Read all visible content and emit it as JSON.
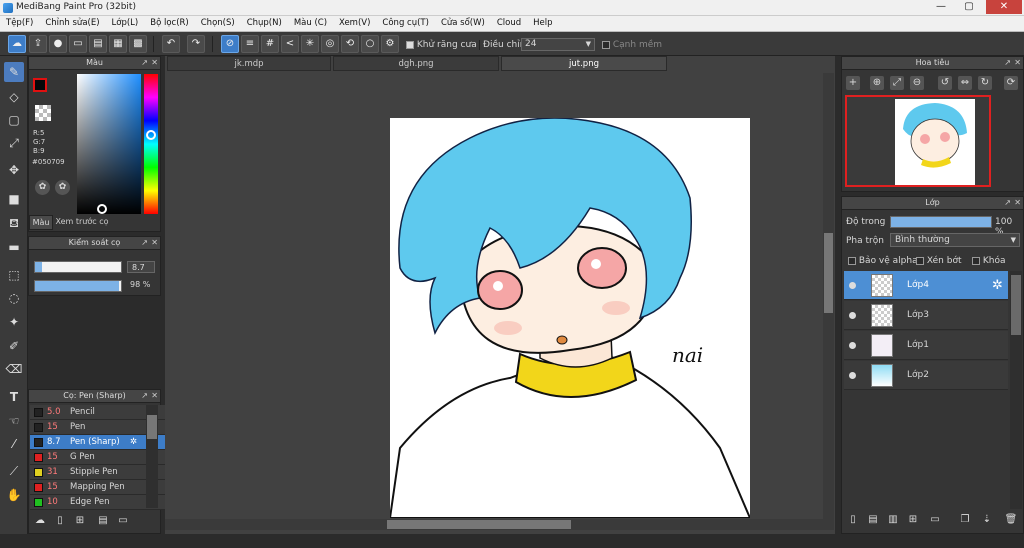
{
  "window": {
    "title": "MediBang Paint Pro (32bit)",
    "minimize": "—",
    "maximize": "▢",
    "close": "✕"
  },
  "menu": [
    "Tệp(F)",
    "Chỉnh sửa(E)",
    "Lớp(L)",
    "Bộ lọc(R)",
    "Chọn(S)",
    "Chụp(N)",
    "Màu (C)",
    "Xem(V)",
    "Công cụ(T)",
    "Cửa sổ(W)",
    "Cloud",
    "Help"
  ],
  "toolbar": {
    "antialias_label": "Khử răng cưa",
    "adjust_label": "Điều chỉnh",
    "adjust_value": "24",
    "edge_label": "Cạnh mềm"
  },
  "color_panel": {
    "title": "Màu",
    "r": "R:5",
    "g": "G:7",
    "b": "B:9",
    "hex": "#050709",
    "tab_color": "Màu",
    "tab_preview": "Xem trước cọ",
    "primary": "#050709",
    "secondary": "#ffffff"
  },
  "brush_control": {
    "title": "Kiểm soát cọ",
    "size_value": "8.7",
    "opacity_value": "98 %",
    "size_fraction": 0.087,
    "opacity_fraction": 0.98
  },
  "brush_list": {
    "title": "Cọ: Pen (Sharp)",
    "items": [
      {
        "size": "5.0",
        "name": "Pencil",
        "color": "#222222"
      },
      {
        "size": "15",
        "name": "Pen",
        "color": "#222222"
      },
      {
        "size": "8.7",
        "name": "Pen (Sharp)",
        "color": "#222222"
      },
      {
        "size": "15",
        "name": "G Pen",
        "color": "#e02020"
      },
      {
        "size": "31",
        "name": "Stipple Pen",
        "color": "#e0d020"
      },
      {
        "size": "15",
        "name": "Mapping Pen",
        "color": "#e02020"
      },
      {
        "size": "10",
        "name": "Edge Pen",
        "color": "#20c020"
      }
    ]
  },
  "tabs": [
    "jk.mdp",
    "dgh.png",
    "jut.png"
  ],
  "navigator": {
    "title": "Hoa tiêu"
  },
  "layer_panel": {
    "title": "Lớp",
    "opacity_label": "Độ trong",
    "opacity_value": "100 %",
    "blend_label": "Pha trộn",
    "blend_value": "Bình thường",
    "protect_alpha": "Bảo vệ alpha",
    "clipping": "Xén bớt",
    "lock": "Khóa",
    "layers": [
      "Lớp4",
      "Lớp3",
      "Lớp1",
      "Lớp2"
    ]
  },
  "artwork": {
    "signature": "nai",
    "hair_color": "#5ec9ee",
    "collar_color": "#f2d61a"
  }
}
